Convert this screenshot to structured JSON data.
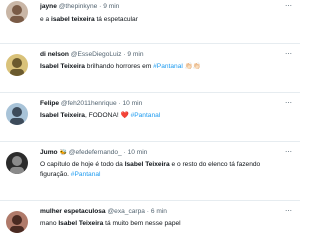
{
  "tweets": [
    {
      "name": "jayne",
      "handle": "@thepinkyne",
      "time": "9 min",
      "text": {
        "t1": "e a ",
        "bold": "isabel teixeira",
        "t2": " tá espetacular"
      },
      "avatar_colors": [
        "#c9b6a6",
        "#7a5b46"
      ]
    },
    {
      "name": "di nelson",
      "handle": "@EsseDiegoLuiz",
      "time": "9 min",
      "text": {
        "bold": "Isabel Teixeira",
        "t1": " brilhando horrores em ",
        "tag": "#Pantanal",
        "emoji": "👏🏻👏🏻"
      },
      "avatar_colors": [
        "#d9c27a",
        "#6b5a2e"
      ]
    },
    {
      "name": "Felipe",
      "handle": "@feh2011henrique",
      "time": "10 min",
      "text": {
        "bold": "Isabel Teixeira",
        "t1": ", FODONA! ",
        "emoji": "❤️",
        "tag": "#Pantanal"
      },
      "avatar_colors": [
        "#a8c3d8",
        "#3d4b5a"
      ]
    },
    {
      "name": "Jumo",
      "handle": "@efedefernando_",
      "time": "10 min",
      "name_emoji": "🐝",
      "text": {
        "t1": "O capítulo de hoje é todo da ",
        "bold": "Isabel Teixeira",
        "t2": " e o resto do elenco tá fazendo figuração. ",
        "tag": "#Pantanal"
      },
      "avatar_colors": [
        "#2b2b2b",
        "#8a8a8a"
      ]
    },
    {
      "name": "mulher espetaculosa",
      "handle": "@exa_carpa",
      "time": "6 min",
      "text": {
        "t1": "mano ",
        "bold": "Isabel Teixeira",
        "t2": " tá muito bem nesse papel"
      },
      "avatar_colors": [
        "#b07a6a",
        "#4a2a22"
      ]
    }
  ],
  "separator": "·",
  "more_icon": "ellipsis-icon"
}
